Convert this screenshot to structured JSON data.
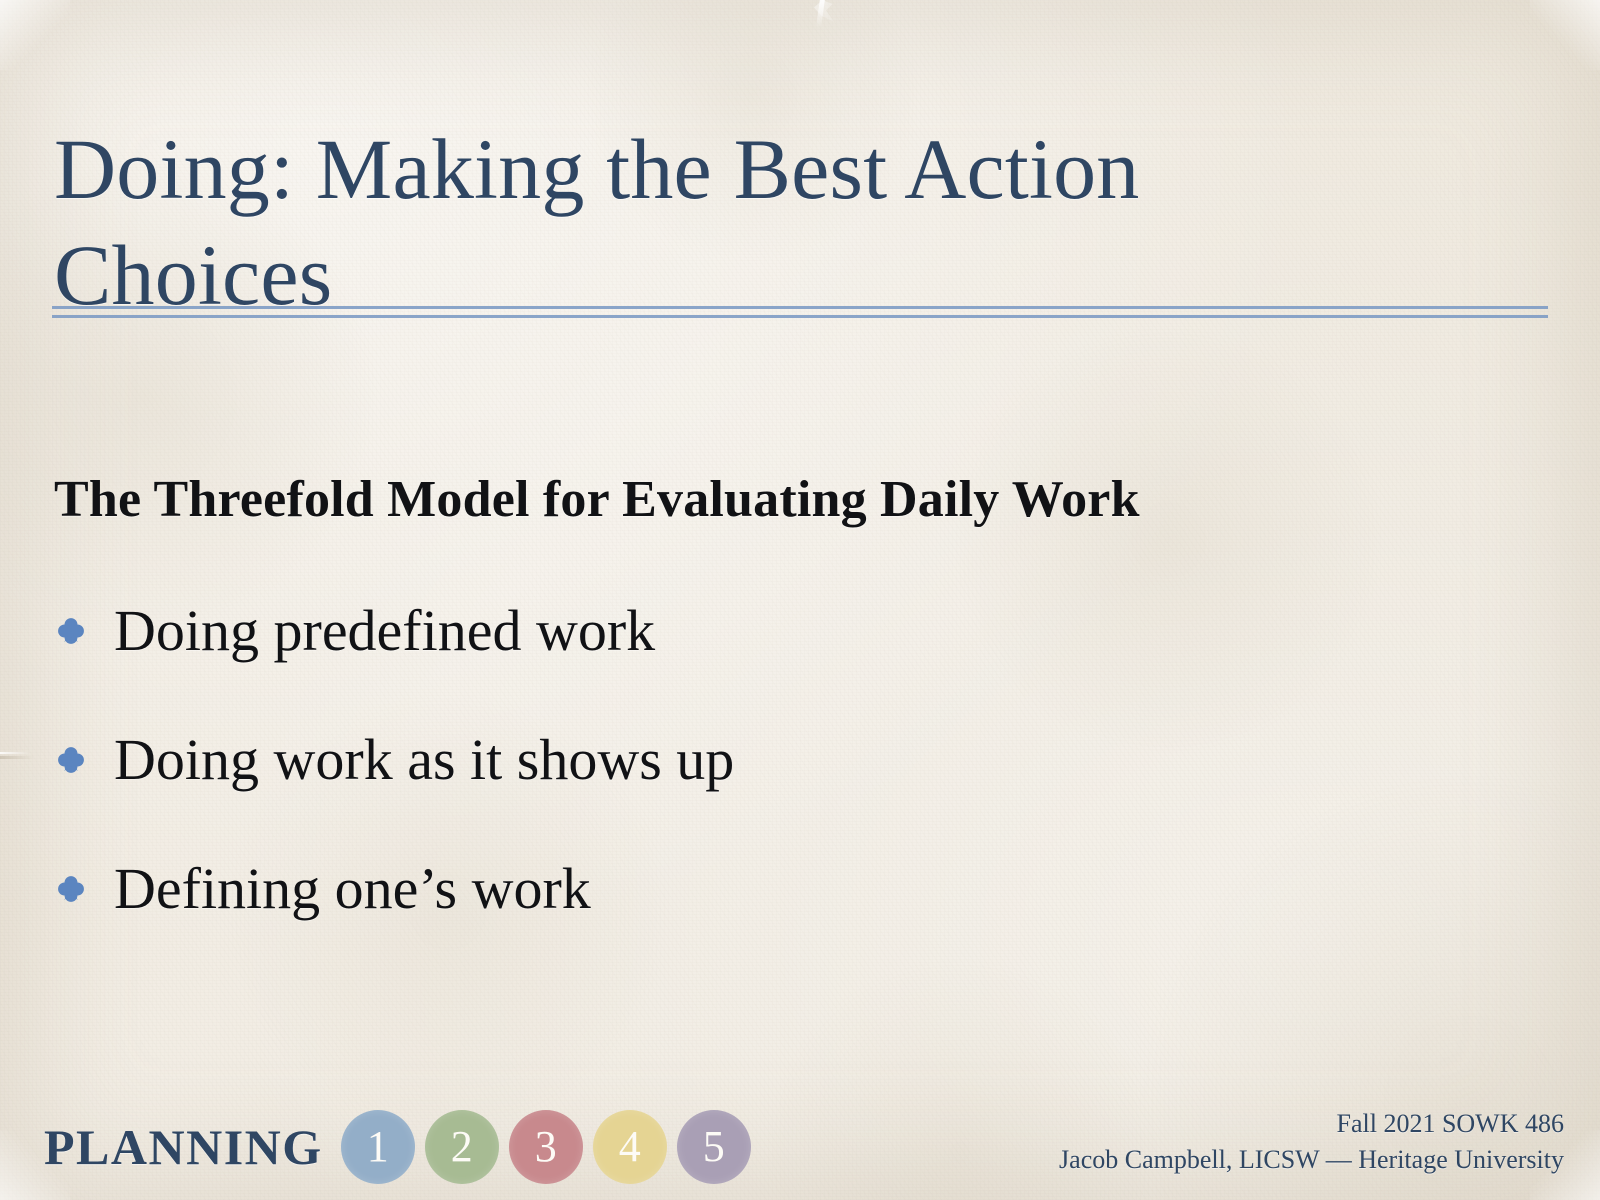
{
  "slide": {
    "background_color": "#f1ece3",
    "title": "Doing: Making the Best Action Choices",
    "title_color": "#2f4663",
    "divider_color": "#7b9ac4"
  },
  "body": {
    "subheading": "The Threefold Model for Evaluating Daily Work",
    "subheading_color": "#111215",
    "bullet_glyph_name": "quatrefoil-bullet-icon",
    "bullet_color": "#5b85c0",
    "bullets": [
      {
        "text": "Doing predefined work"
      },
      {
        "text": "Doing work as it shows up"
      },
      {
        "text": "Defining one’s work"
      }
    ]
  },
  "footer": {
    "planning_label": "Planning",
    "planning_color": "#2f4663",
    "steps": [
      {
        "number": "1",
        "color": "#93aec8"
      },
      {
        "number": "2",
        "color": "#a7bb93"
      },
      {
        "number": "3",
        "color": "#c8898d"
      },
      {
        "number": "4",
        "color": "#e5d493"
      },
      {
        "number": "5",
        "color": "#a99fb5"
      }
    ],
    "course_line": "Fall 2021 SOWK 486",
    "attribution_line": "Jacob Campbell, LICSW — Heritage University"
  }
}
